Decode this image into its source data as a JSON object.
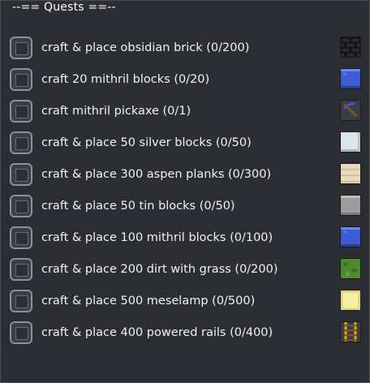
{
  "panel": {
    "title": "--== Quests ==--"
  },
  "quests": [
    {
      "label": "craft & place obsidian brick (0/200)",
      "icon": "obsidian-brick-icon",
      "color": "#151515"
    },
    {
      "label": "craft 20 mithril blocks (0/20)",
      "icon": "mithril-block-icon",
      "color": "#3d5bd3"
    },
    {
      "label": "craft mithril pickaxe (0/1)",
      "icon": "mithril-pickaxe-icon",
      "color": "#3f4cb0"
    },
    {
      "label": "craft & place 50 silver blocks (0/50)",
      "icon": "silver-block-icon",
      "color": "#d9e6ee"
    },
    {
      "label": "craft & place 300 aspen planks (0/300)",
      "icon": "aspen-planks-icon",
      "color": "#e7dbbf"
    },
    {
      "label": "craft & place 50 tin blocks (0/50)",
      "icon": "tin-block-icon",
      "color": "#9c9c9c"
    },
    {
      "label": "craft & place 100 mithril blocks (0/100)",
      "icon": "mithril-block-icon",
      "color": "#3d5bd3"
    },
    {
      "label": "craft & place 200 dirt with grass (0/200)",
      "icon": "dirt-with-grass-icon",
      "color": "#4f8a2c"
    },
    {
      "label": "craft & place 500 meselamp (0/500)",
      "icon": "meselamp-icon",
      "color": "#f3f0a3"
    },
    {
      "label": "craft & place 400 powered rails (0/400)",
      "icon": "powered-rails-icon",
      "color": "#e0b000"
    }
  ]
}
